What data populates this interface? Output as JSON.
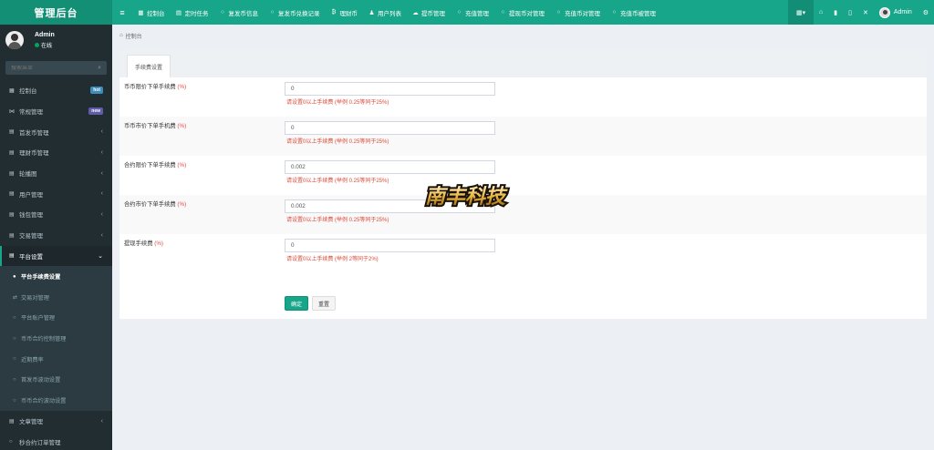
{
  "brand": {
    "title": "管理后台"
  },
  "topnav": [
    {
      "icon": "dashboard-icon",
      "glyph": "▦",
      "label": "控制台"
    },
    {
      "icon": "calendar-icon",
      "glyph": "▤",
      "label": "定时任务"
    },
    {
      "icon": "circle-icon",
      "glyph": "○",
      "label": "复发币信息"
    },
    {
      "icon": "circle-icon",
      "glyph": "○",
      "label": "复发币兑换记录"
    },
    {
      "icon": "bitcoin-icon",
      "glyph": "₿",
      "label": "理财币"
    },
    {
      "icon": "user-icon",
      "glyph": "♟",
      "label": "用户列表"
    },
    {
      "icon": "cloud-download-icon",
      "glyph": "☁",
      "label": "提币管理"
    },
    {
      "icon": "circle-icon",
      "glyph": "○",
      "label": "充值管理"
    },
    {
      "icon": "circle-icon",
      "glyph": "○",
      "label": "提现币对管理"
    },
    {
      "icon": "circle-icon",
      "glyph": "○",
      "label": "充值币对管理"
    },
    {
      "icon": "circle-icon",
      "glyph": "○",
      "label": "充值币被管理"
    }
  ],
  "topright": {
    "grid_glyph": "▦▾",
    "home_glyph": "⌂",
    "file_glyph": "▮",
    "copy_glyph": "▯",
    "expand_glyph": "✕",
    "user_name": "Admin",
    "settings_glyph": "⚙"
  },
  "user": {
    "name": "Admin",
    "status": "在线"
  },
  "search": {
    "placeholder": "搜索菜单",
    "glyph": "⌕"
  },
  "menu": [
    {
      "icon": "dashboard-icon",
      "glyph": "▦",
      "label": "控制台",
      "badge": "hot",
      "badge_type": "hot",
      "chevron": ""
    },
    {
      "icon": "share-icon",
      "glyph": "⋈",
      "label": "常规管理",
      "badge": "new",
      "badge_type": "new",
      "chevron": ""
    },
    {
      "icon": "list-icon",
      "glyph": "▤",
      "label": "首发币管理",
      "badge": "",
      "badge_type": "",
      "chevron": "‹"
    },
    {
      "icon": "list-icon",
      "glyph": "▤",
      "label": "理财币管理",
      "badge": "",
      "badge_type": "",
      "chevron": "‹"
    },
    {
      "icon": "list-icon",
      "glyph": "▤",
      "label": "轮播图",
      "badge": "",
      "badge_type": "",
      "chevron": "‹"
    },
    {
      "icon": "list-icon",
      "glyph": "▤",
      "label": "用户管理",
      "badge": "",
      "badge_type": "",
      "chevron": "‹"
    },
    {
      "icon": "list-icon",
      "glyph": "▤",
      "label": "钱包管理",
      "badge": "",
      "badge_type": "",
      "chevron": "‹"
    },
    {
      "icon": "list-icon",
      "glyph": "▤",
      "label": "交易管理",
      "badge": "",
      "badge_type": "",
      "chevron": "‹"
    },
    {
      "icon": "list-icon",
      "glyph": "▤",
      "label": "平台设置",
      "badge": "",
      "badge_type": "",
      "chevron": "⌄"
    }
  ],
  "submenu": [
    {
      "icon": "circle-icon",
      "glyph": "●",
      "label": "平台手续费设置"
    },
    {
      "icon": "exchange-icon",
      "glyph": "⇄",
      "label": "交易对管理"
    },
    {
      "icon": "circle-icon",
      "glyph": "○",
      "label": "平台账户管理"
    },
    {
      "icon": "circle-icon",
      "glyph": "○",
      "label": "币币合约控制管理"
    },
    {
      "icon": "circle-icon",
      "glyph": "○",
      "label": "近期费率"
    },
    {
      "icon": "circle-icon",
      "glyph": "○",
      "label": "首发币波动设置"
    },
    {
      "icon": "circle-icon",
      "glyph": "○",
      "label": "币币合约波动设置"
    }
  ],
  "menu_after": [
    {
      "icon": "list-icon",
      "glyph": "▤",
      "label": "文章管理",
      "chevron": "‹"
    },
    {
      "icon": "circle-icon",
      "glyph": "○",
      "label": "秒合约订单管理",
      "chevron": ""
    }
  ],
  "breadcrumb": {
    "glyph": "⌂",
    "label": "控制台"
  },
  "tab": {
    "label": "手续费设置"
  },
  "form": [
    {
      "label": "币币限价下单手续费",
      "req": "(%)",
      "value": "0",
      "hint": "请设置0以上手续费 (举例 0.25等同于25%)"
    },
    {
      "label": "币币市价下单手机费",
      "req": "(%)",
      "value": "0",
      "hint": "请设置0以上手续费 (举例 0.25等同于25%)"
    },
    {
      "label": "合约限价下单手续费",
      "req": "(%)",
      "value": "0.002",
      "hint": "请设置0以上手续费 (举例 0.25等同于25%)"
    },
    {
      "label": "合约市价下单手续费",
      "req": "(%)",
      "value": "0.002",
      "hint": "请设置0以上手续费 (举例 0.25等同于25%)"
    },
    {
      "label": "提现手续费",
      "req": "(%)",
      "value": "0",
      "hint": "请设置0以上手续费 (举例 2等同于2%)"
    }
  ],
  "buttons": {
    "submit": "确定",
    "reset": "重置"
  },
  "watermark": {
    "text": "南丰科技"
  }
}
